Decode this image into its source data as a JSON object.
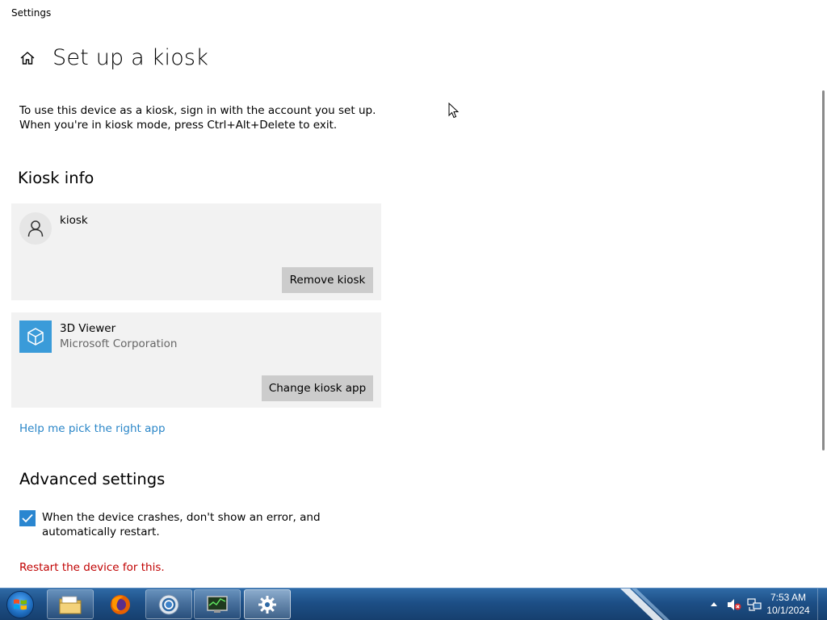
{
  "window": {
    "title": "Settings"
  },
  "header": {
    "title": "Set up a kiosk"
  },
  "description": "To use this device as a kiosk, sign in with the account you set up. When you're in kiosk mode, press Ctrl+Alt+Delete to exit.",
  "kiosk_info": {
    "heading": "Kiosk info",
    "account_name": "kiosk",
    "remove_label": "Remove kiosk",
    "app_name": "3D Viewer",
    "app_publisher": "Microsoft Corporation",
    "change_label": "Change kiosk app"
  },
  "help_link": "Help me pick the right app",
  "advanced": {
    "heading": "Advanced settings",
    "crash_option": {
      "label": "When the device crashes, don't show an error, and automatically restart.",
      "checked": true
    },
    "restart_note": "Restart the device for this."
  },
  "taskbar": {
    "items": [
      "start-orb",
      "file-explorer-icon",
      "firefox-icon",
      "chrome-icon",
      "system-monitor-icon",
      "settings-icon"
    ],
    "clock_time": "7:53 AM",
    "clock_date": "10/1/2024"
  },
  "colors": {
    "accent": "#2a86d0",
    "link": "#2a86c8",
    "warning": "#c00000",
    "card": "#f2f2f2",
    "button": "#cccccc",
    "app_tile": "#3a9bd9"
  }
}
